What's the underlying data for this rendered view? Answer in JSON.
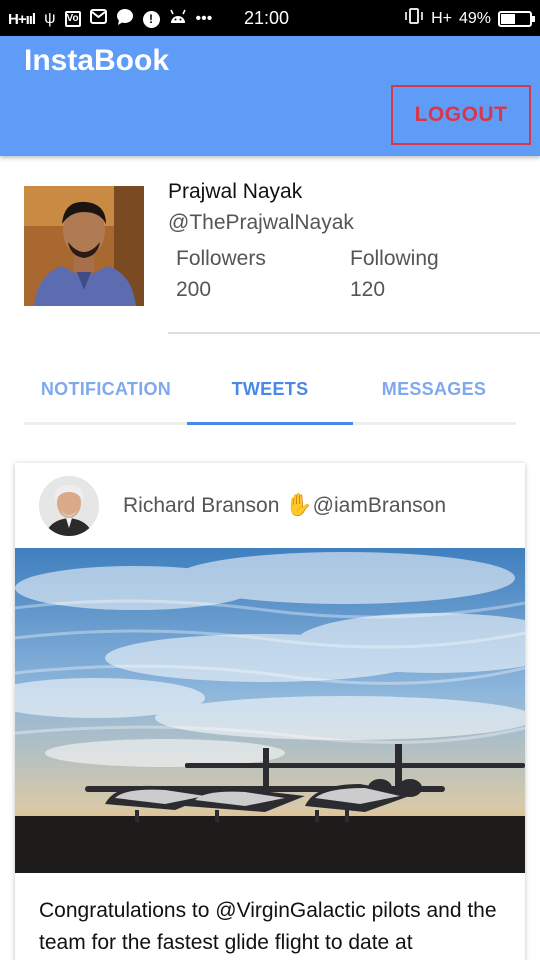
{
  "status_bar": {
    "network": "H+ııl",
    "time": "21:00",
    "right_network": "H+",
    "battery": "49%",
    "battery_level": 0.49,
    "icons": [
      "usb-icon",
      "volte-icon",
      "mail-icon",
      "chat-icon",
      "alert-icon",
      "android-icon",
      "more-icon",
      "vibrate-icon",
      "signal-icon",
      "battery-icon"
    ]
  },
  "app_bar": {
    "title": "InstaBook",
    "logout_label": "LOGOUT",
    "color": "#5e9cf7",
    "logout_color": "#d6374a"
  },
  "profile": {
    "name": "Prajwal Nayak",
    "handle": "@ThePrajwalNayak",
    "followers_label": "Followers",
    "followers_count": "200",
    "following_label": "Following",
    "following_count": "120"
  },
  "tabs": {
    "items": [
      {
        "label": "NOTIFICATION"
      },
      {
        "label": "TWEETS"
      },
      {
        "label": "MESSAGES"
      }
    ],
    "active_index": 1,
    "accent": "#4a88e8"
  },
  "post": {
    "author": "Richard Branson",
    "handle": "@iamBranson",
    "text": "Congratulations to @VirginGalactic pilots and the team for the fastest glide flight to date at"
  }
}
